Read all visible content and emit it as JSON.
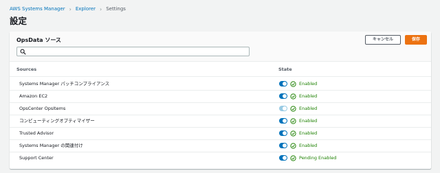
{
  "breadcrumb": {
    "items": [
      "AWS Systems Manager",
      "Explorer",
      "Settings"
    ]
  },
  "page": {
    "title": "設定"
  },
  "card": {
    "title": "OpsData ソース",
    "cancel_label": "キャンセル",
    "save_label": "保存",
    "search": {
      "value": "",
      "placeholder": ""
    }
  },
  "table": {
    "columns": {
      "sources": "Sources",
      "state": "State"
    },
    "rows": [
      {
        "name": "Systems Manager パッチコンプライアンス",
        "state": "Enabled"
      },
      {
        "name": "Amazon EC2",
        "state": "Enabled"
      },
      {
        "name": "OpsCenter OpsItems",
        "state": "Enabled"
      },
      {
        "name": "コンピューティングオプティマイザー",
        "state": "Enabled"
      },
      {
        "name": "Trusted Advisor",
        "state": "Enabled"
      },
      {
        "name": "Systems Manager の関連付け",
        "state": "Enabled"
      },
      {
        "name": "Support Center",
        "state": "Pending Enabled"
      }
    ]
  },
  "colors": {
    "link": "#0073bb",
    "primary_button": "#ec7211",
    "toggle_on": "#0073bb",
    "toggle_disabled": "#99cbe4",
    "status_success": "#1d8102"
  },
  "icons": {
    "search": "search-icon",
    "status": "check-circle-icon",
    "breadcrumb_separator": "chevron-right-icon"
  }
}
